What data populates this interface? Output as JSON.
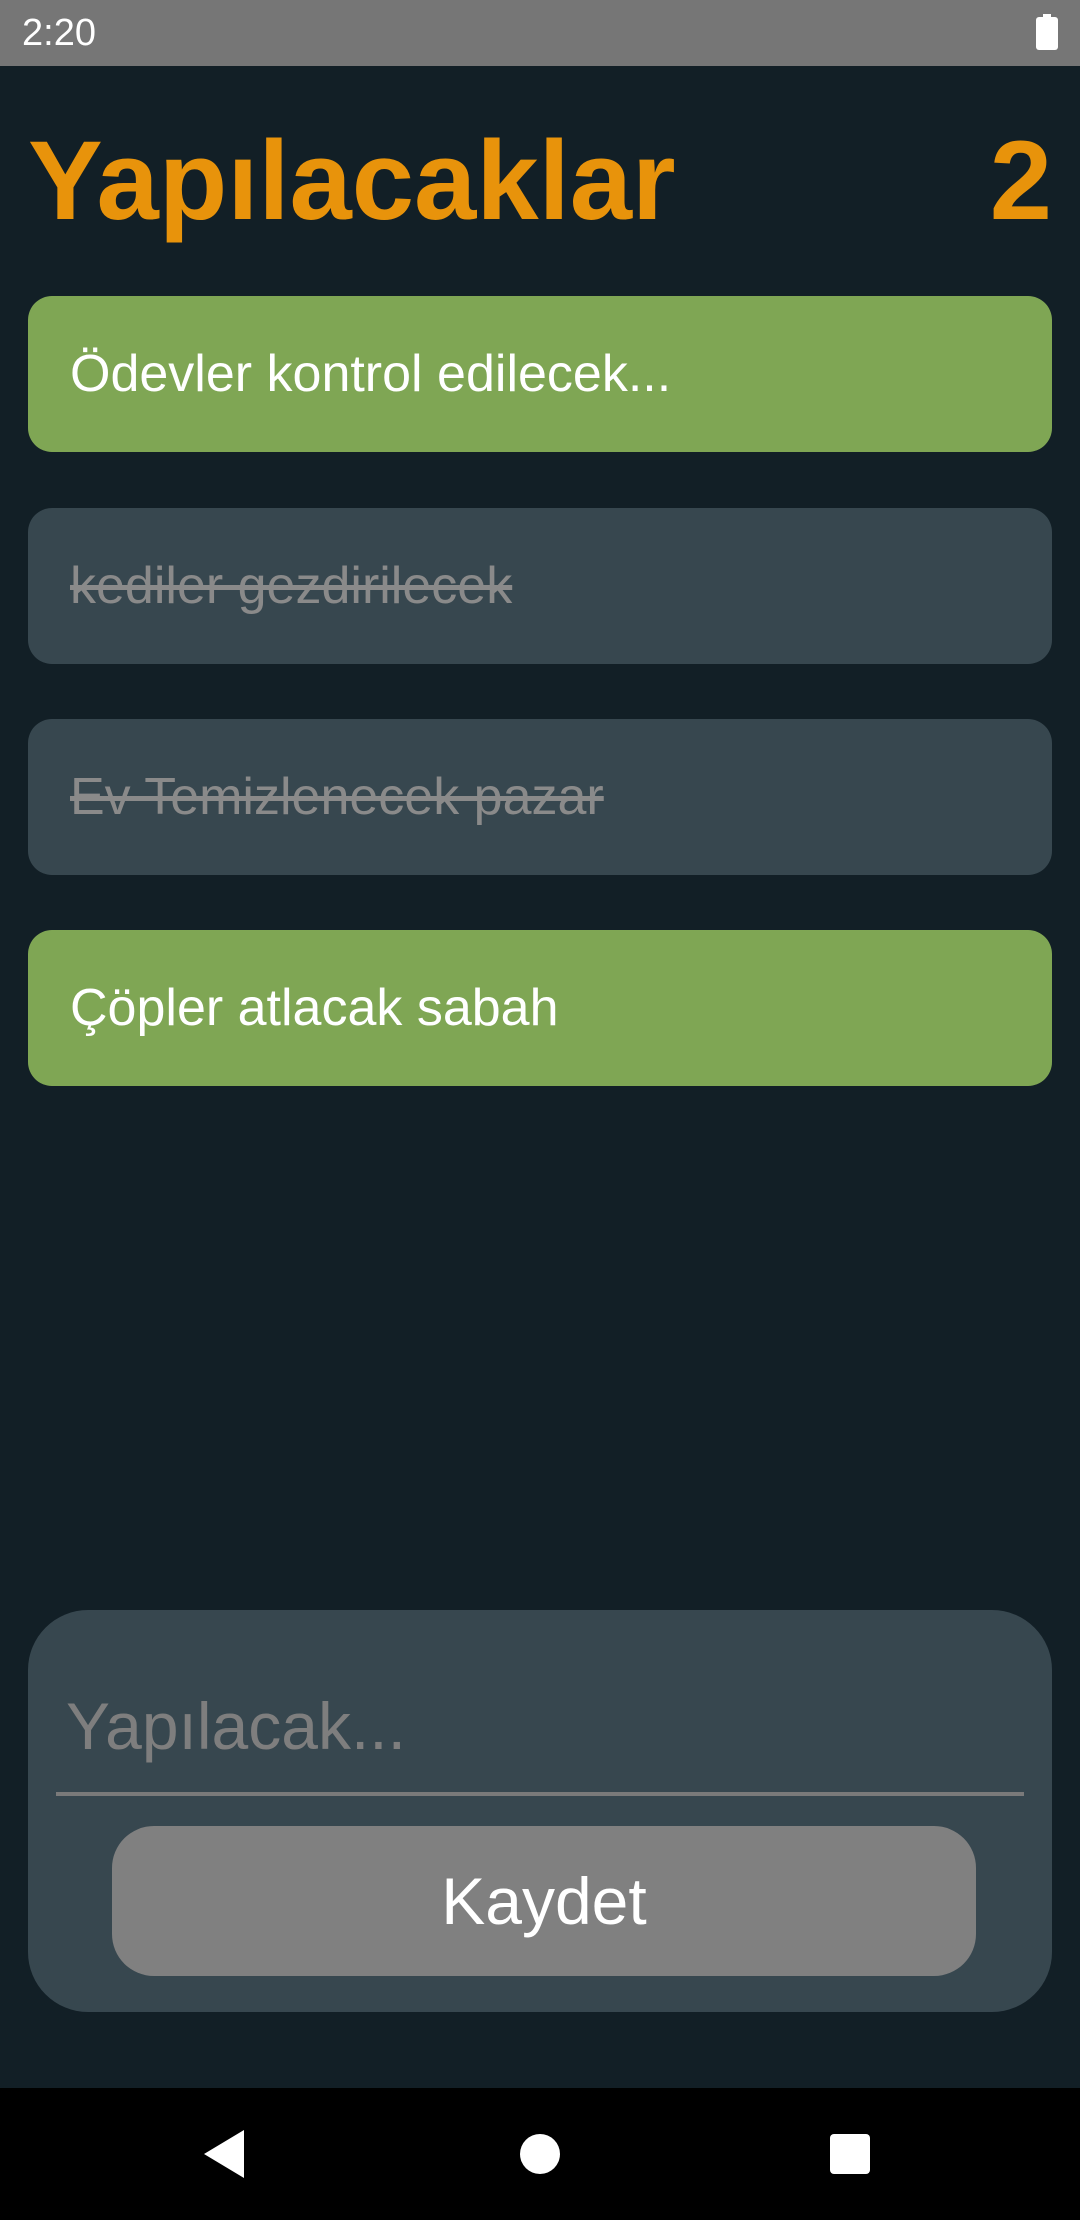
{
  "status_bar": {
    "time": "2:20",
    "battery_icon": "battery-full-icon"
  },
  "header": {
    "title": "Yapılacaklar",
    "count": "2"
  },
  "tasks": [
    {
      "text": "Ödevler kontrol edilecek...",
      "completed": false
    },
    {
      "text": "kediler gezdirilecek",
      "completed": true
    },
    {
      "text": "Ev Temizlenecek pazar",
      "completed": true
    },
    {
      "text": "Çöpler atlacak sabah",
      "completed": false
    }
  ],
  "input_panel": {
    "placeholder": "Yapılacak...",
    "value": "",
    "save_label": "Kaydet"
  },
  "nav_bar": {
    "back_icon": "back-triangle-icon",
    "home_icon": "home-circle-icon",
    "recents_icon": "recents-square-icon"
  },
  "colors": {
    "background": "#121f26",
    "accent": "#e8930b",
    "active_task": "#7fa654",
    "done_task": "#37474f",
    "button": "#808080"
  }
}
